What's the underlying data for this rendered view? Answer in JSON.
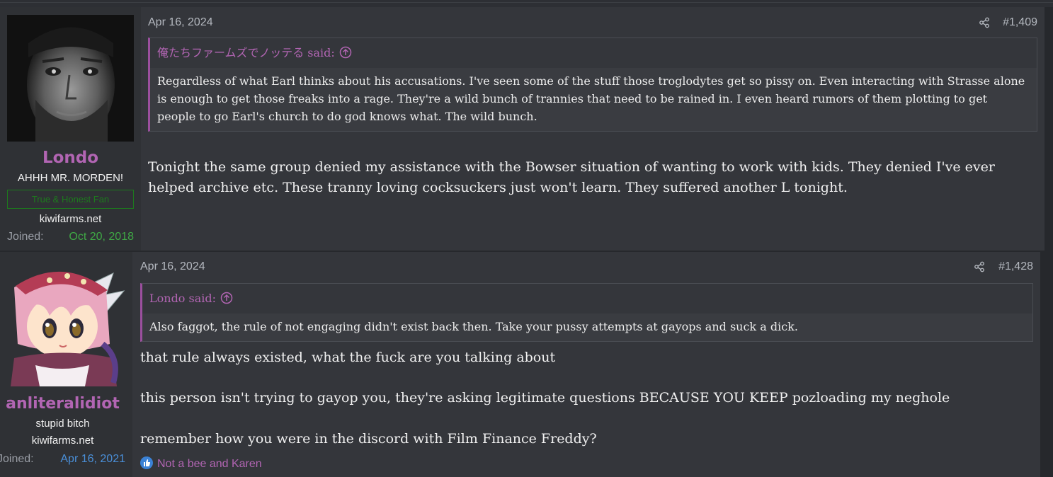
{
  "posts": [
    {
      "username": "Londo",
      "user_title": "AHHH MR. MORDEN!",
      "banner": "True & Honest Fan",
      "site": "kiwifarms.net",
      "joined_label": "Joined:",
      "joined_date": "Oct 20, 2018",
      "post_date": "Apr 16, 2024",
      "post_number": "#1,409",
      "quote_author": "俺たちファームズでノッテる said:",
      "quote_text": "Regardless of what Earl thinks about his accusations. I've seen some of the stuff those troglodytes get so pissy on. Even interacting with Strasse alone is enough to get those freaks into a rage. They're a wild bunch of trannies that need to be rained in. I even heard rumors of them plotting to get people to go Earl's church to do god knows what. The wild bunch.",
      "message": "Tonight the same group denied my assistance with the Bowser situation of wanting to work with kids. They denied I've ever helped archive etc. These tranny loving cocksuckers just won't learn. They suffered another L tonight."
    },
    {
      "username": "anliteralidiot",
      "user_title": "stupid bitch",
      "site": "kiwifarms.net",
      "joined_label": "Joined:",
      "joined_date": "Apr 16, 2021",
      "post_date": "Apr 16, 2024",
      "post_number": "#1,428",
      "quote_author": "Londo said:",
      "quote_text": "Also faggot, the rule of not engaging didn't exist back then. Take your pussy attempts at gayops and suck a dick.",
      "message_lines": [
        "that rule always existed, what the fuck are you talking about",
        "this person isn't trying to gayop you, they're asking legitimate questions BECAUSE YOU KEEP pozloading my neghole",
        "remember how you were in the discord with Film Finance Freddy?"
      ],
      "reactions": "Not a bee and Karen"
    }
  ],
  "colors": {
    "username": "#b265b3",
    "joined_date_1": "#3fa845",
    "joined_date_2": "#4a8fd8",
    "banner_green": "#1d7a1d",
    "quote_bar": "#9b4f9e",
    "like_blue": "#3b82d6"
  },
  "icons": {
    "share": "share-icon",
    "expand_quote": "arrow-up-circle-icon",
    "like": "like-icon"
  }
}
